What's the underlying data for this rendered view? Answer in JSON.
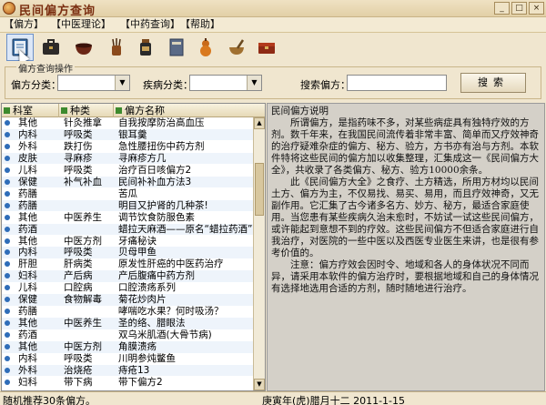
{
  "window": {
    "title": "民间偏方查询",
    "controls": [
      "_",
      "□",
      "×"
    ]
  },
  "menu": [
    "【偏方】",
    "【中医理论】",
    "【中药查询】",
    "【帮助】"
  ],
  "toolbar": [
    "book-icon",
    "briefcase-icon",
    "bowl-icon",
    "brush-holder-icon",
    "medicine-bottle-icon",
    "herb-book-icon",
    "gourd-icon",
    "mortar-pestle-icon",
    "box-icon"
  ],
  "query": {
    "group_label": "偏方查询操作",
    "category_label": "偏方分类：",
    "disease_label": "疾病分类：",
    "keyword_label": "搜索偏方：",
    "category_value": "",
    "disease_value": "",
    "keyword_value": "",
    "search_label": "搜索"
  },
  "table": {
    "headers": [
      "科室",
      "种类",
      "偏方名称"
    ],
    "rows": [
      [
        "其他",
        "针灸推拿",
        "自我按摩防治高血压"
      ],
      [
        "内科",
        "呼吸类",
        "银耳羹"
      ],
      [
        "外科",
        "跌打伤",
        "急性腰扭伤中药方剂"
      ],
      [
        "皮肤",
        "寻麻疹",
        "寻麻疹方几"
      ],
      [
        "儿科",
        "呼吸类",
        "治疗百日咳偏方2"
      ],
      [
        "保健",
        "补气补血",
        "民间补补血方法3"
      ],
      [
        "药膳",
        "",
        "苦瓜"
      ],
      [
        "药膳",
        "",
        "明目又护肾的几种茶!"
      ],
      [
        "其他",
        "中医养生",
        "调节饮食防服色素"
      ],
      [
        "药酒",
        "",
        "蜡拉天麻酒——原名“蜡拉药酒”"
      ],
      [
        "其他",
        "中医方剂",
        "牙痛秘诀"
      ],
      [
        "内科",
        "呼吸类",
        "贝母甲鱼"
      ],
      [
        "肝胆",
        "肝病类",
        "原发性肝癌的中医药治疗"
      ],
      [
        "妇科",
        "产后病",
        "产后腹痛中药方剂"
      ],
      [
        "儿科",
        "口腔病",
        "口腔溃疡系列"
      ],
      [
        "保健",
        "食物解毒",
        "菊花炒肉片"
      ],
      [
        "药膳",
        "",
        "哮喘吃水果？何时吸汤？"
      ],
      [
        "其他",
        "中医养生",
        "圣的络、腊眼法"
      ],
      [
        "药酒",
        "",
        "双乌米肌酒(大骨节病)"
      ],
      [
        "其他",
        "中医方剂",
        "角膜溃疡"
      ],
      [
        "内科",
        "呼吸类",
        "川明参炖鳖鱼"
      ],
      [
        "外科",
        "治烧疮",
        "痔疮13"
      ],
      [
        "妇科",
        "带下病",
        "带下偏方2"
      ]
    ]
  },
  "description": {
    "title": "民间偏方说明",
    "paragraphs": [
      "所谓偏方，是指药味不多，对某些病症具有独特疗效的方剂。数千年来，在我国民间流传着非常丰富、简单而又疗效神奇的治疗疑难杂症的偏方、秘方、验方，方书亦有治与方剂。本软件特将这些民间的偏方加以收集整理，汇集成这一《民间偏方大全》，共收录了各类偏方、秘方、验方10000余条。",
      "此《民间偏方大全》之食疗、土方精选，所用方材均以民间土方、偏方为主，不仅易找、易买、易用，而且疗效神奇，又无副作用。它汇集了古今诸多名方、妙方、秘方，最适合家庭使用。当您患有某些疾病久治未愈时，不妨试一试这些民间偏方，或许能起到意想不到的疗效。这些民间偏方不但适合家庭进行自我治疗，对医院的一些中医以及西医专业医生来讲，也是很有参考价值的。",
      "注意：偏方疗效会因时令、地域和各人的身体状况不同而异，请采用本软件的偏方治疗时，要根据地域和自己的身体情况有选择地选用合适的方剂，随时随地进行治疗。"
    ]
  },
  "status": {
    "left": "随机推荐30条偏方。",
    "right": "庚寅年(虎)腊月十二  2011-1-15"
  }
}
